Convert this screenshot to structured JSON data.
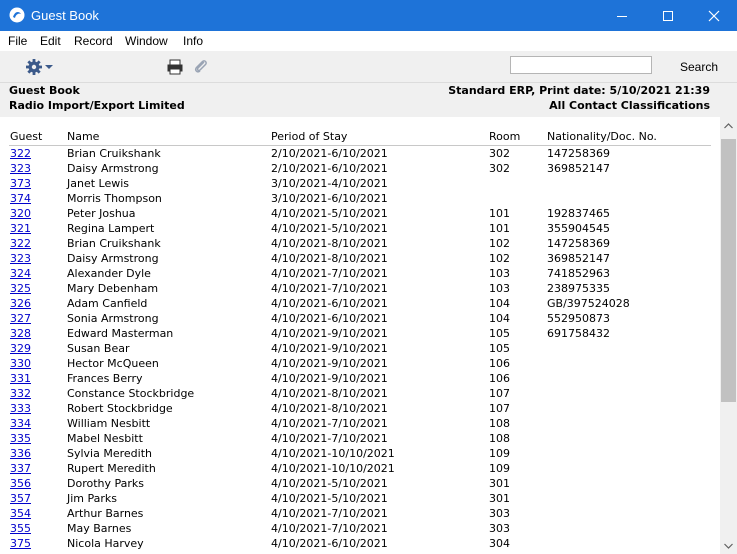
{
  "window": {
    "title": "Guest Book"
  },
  "menu": [
    "File",
    "Edit",
    "Record",
    "Window",
    "Info"
  ],
  "toolbar": {
    "search_value": "",
    "search_label": "Search"
  },
  "report": {
    "name": "Guest Book",
    "company": "Radio Import/Export Limited",
    "print_info": "Standard ERP, Print date: 5/10/2021 21:39",
    "classification": "All Contact Classifications"
  },
  "columns": {
    "guest": "Guest",
    "name": "Name",
    "period": "Period of Stay",
    "room": "Room",
    "nationality": "Nationality/Doc. No."
  },
  "rows": [
    [
      "322",
      "Brian Cruikshank",
      "2/10/2021-6/10/2021",
      "302",
      "147258369"
    ],
    [
      "323",
      "Daisy Armstrong",
      "2/10/2021-6/10/2021",
      "302",
      "369852147"
    ],
    [
      "373",
      "Janet Lewis",
      "3/10/2021-4/10/2021",
      "",
      ""
    ],
    [
      "374",
      "Morris Thompson",
      "3/10/2021-6/10/2021",
      "",
      ""
    ],
    [
      "320",
      "Peter Joshua",
      "4/10/2021-5/10/2021",
      "101",
      "192837465"
    ],
    [
      "321",
      "Regina Lampert",
      "4/10/2021-5/10/2021",
      "101",
      "355904545"
    ],
    [
      "322",
      "Brian Cruikshank",
      "4/10/2021-8/10/2021",
      "102",
      "147258369"
    ],
    [
      "323",
      "Daisy Armstrong",
      "4/10/2021-8/10/2021",
      "102",
      "369852147"
    ],
    [
      "324",
      "Alexander Dyle",
      "4/10/2021-7/10/2021",
      "103",
      "741852963"
    ],
    [
      "325",
      "Mary Debenham",
      "4/10/2021-7/10/2021",
      "103",
      "238975335"
    ],
    [
      "326",
      "Adam Canfield",
      "4/10/2021-6/10/2021",
      "104",
      "GB/397524028"
    ],
    [
      "327",
      "Sonia Armstrong",
      "4/10/2021-6/10/2021",
      "104",
      "552950873"
    ],
    [
      "328",
      "Edward Masterman",
      "4/10/2021-9/10/2021",
      "105",
      "691758432"
    ],
    [
      "329",
      "Susan Bear",
      "4/10/2021-9/10/2021",
      "105",
      ""
    ],
    [
      "330",
      "Hector McQueen",
      "4/10/2021-9/10/2021",
      "106",
      ""
    ],
    [
      "331",
      "Frances Berry",
      "4/10/2021-9/10/2021",
      "106",
      ""
    ],
    [
      "332",
      "Constance Stockbridge",
      "4/10/2021-8/10/2021",
      "107",
      ""
    ],
    [
      "333",
      "Robert Stockbridge",
      "4/10/2021-8/10/2021",
      "107",
      ""
    ],
    [
      "334",
      "William Nesbitt",
      "4/10/2021-7/10/2021",
      "108",
      ""
    ],
    [
      "335",
      "Mabel Nesbitt",
      "4/10/2021-7/10/2021",
      "108",
      ""
    ],
    [
      "336",
      "Sylvia Meredith",
      "4/10/2021-10/10/2021",
      "109",
      ""
    ],
    [
      "337",
      "Rupert Meredith",
      "4/10/2021-10/10/2021",
      "109",
      ""
    ],
    [
      "356",
      "Dorothy Parks",
      "4/10/2021-5/10/2021",
      "301",
      ""
    ],
    [
      "357",
      "Jim Parks",
      "4/10/2021-5/10/2021",
      "301",
      ""
    ],
    [
      "354",
      "Arthur Barnes",
      "4/10/2021-7/10/2021",
      "303",
      ""
    ],
    [
      "355",
      "May Barnes",
      "4/10/2021-7/10/2021",
      "303",
      ""
    ],
    [
      "375",
      "Nicola Harvey",
      "4/10/2021-6/10/2021",
      "304",
      ""
    ]
  ],
  "icons": {
    "app": "app-logo-icon",
    "settings": "gear-icon",
    "print": "printer-icon",
    "attach": "paperclip-icon"
  },
  "colors": {
    "titlebar": "#1e73d8",
    "link": "#0000cc"
  }
}
